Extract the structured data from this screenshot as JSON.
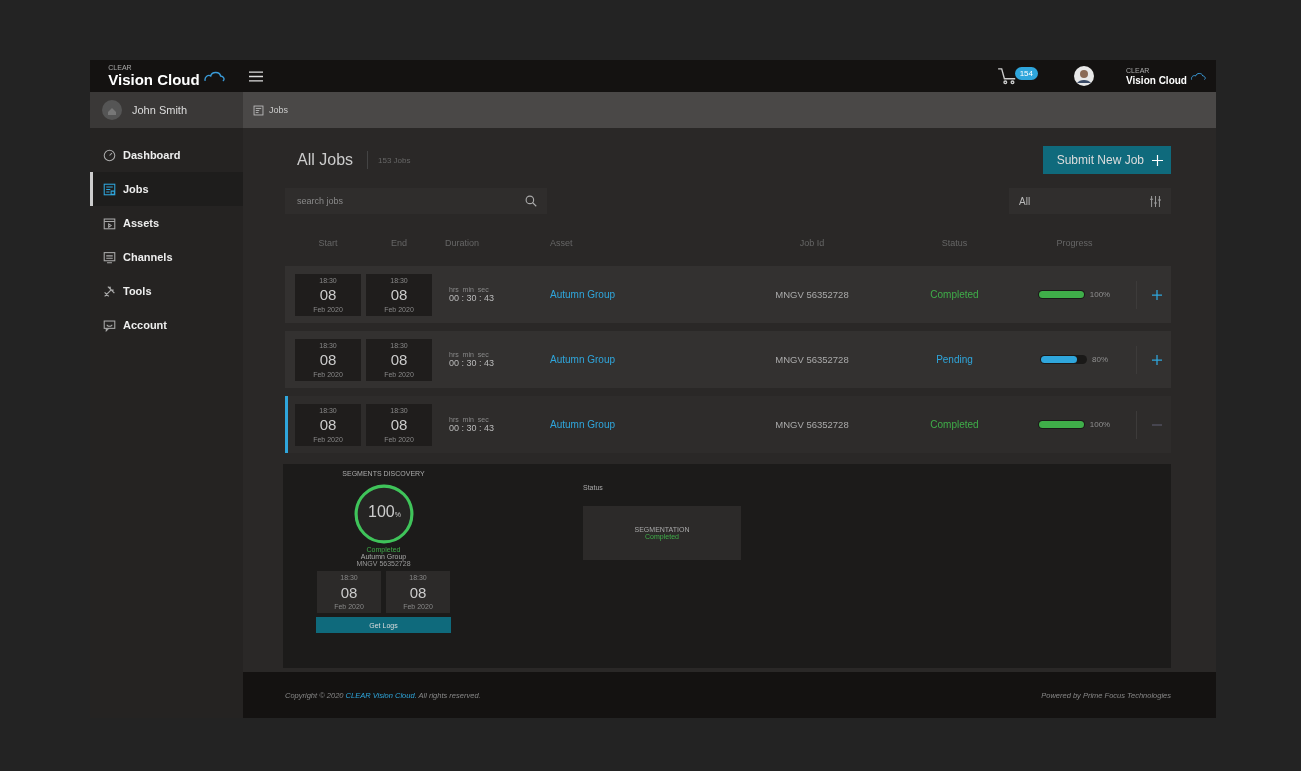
{
  "header": {
    "brand": {
      "tag": "CLEAR",
      "name": "Vision Cloud"
    },
    "cart_count": "154",
    "partner_brand": {
      "tag": "CLEAR",
      "name": "Vision Cloud"
    }
  },
  "sidebar": {
    "user": "John Smith",
    "items": [
      {
        "label": "Dashboard",
        "selected": false
      },
      {
        "label": "Jobs",
        "selected": true
      },
      {
        "label": "Assets",
        "selected": false
      },
      {
        "label": "Channels",
        "selected": false
      },
      {
        "label": "Tools",
        "selected": false
      },
      {
        "label": "Account",
        "selected": false
      }
    ]
  },
  "breadcrumb": "Jobs",
  "title": "All Jobs",
  "count": "153 Jobs",
  "submit_button": "Submit New Job",
  "search": {
    "placeholder": "search jobs"
  },
  "filter": {
    "value": "All"
  },
  "table": {
    "columns": [
      "Start",
      "End",
      "Duration",
      "Asset",
      "Job Id",
      "Status",
      "Progress"
    ],
    "rows": [
      {
        "start": {
          "time": "18:30",
          "day": "08",
          "month": "Feb 2020"
        },
        "end": {
          "time": "18:30",
          "day": "08",
          "month": "Feb 2020"
        },
        "duration_units": [
          "hrs",
          "min",
          "sec"
        ],
        "duration": "00 : 30 : 43",
        "asset": "Autumn Group",
        "job_id": "MNGV 56352728",
        "status": {
          "text": "Completed",
          "kind": "completed"
        },
        "level": 1,
        "reading": "100%",
        "expanded": false
      },
      {
        "start": {
          "time": "18:30",
          "day": "08",
          "month": "Feb 2020"
        },
        "end": {
          "time": "18:30",
          "day": "08",
          "month": "Feb 2020"
        },
        "duration_units": [
          "hrs",
          "min",
          "sec"
        ],
        "duration": "00 : 30 : 43",
        "asset": "Autumn Group",
        "job_id": "MNGV 56352728",
        "status": {
          "text": "Pending",
          "kind": "pending"
        },
        "level": 0.8,
        "reading": "80%",
        "expanded": false
      },
      {
        "start": {
          "time": "18:30",
          "day": "08",
          "month": "Feb 2020"
        },
        "end": {
          "time": "18:30",
          "day": "08",
          "month": "Feb 2020"
        },
        "duration_units": [
          "hrs",
          "min",
          "sec"
        ],
        "duration": "00 : 30 : 43",
        "asset": "Autumn Group",
        "job_id": "MNGV 56352728",
        "status": {
          "text": "Completed",
          "kind": "completed"
        },
        "level": 1,
        "reading": "100%",
        "expanded": true
      }
    ]
  },
  "detail": {
    "title": "SEGMENTS DISCOVERY",
    "percent": "100",
    "unit": "%",
    "level": 1,
    "status": "Completed",
    "asset": "Autumn Group",
    "job_id": "MNGV 56352728",
    "start": {
      "time": "18:30",
      "day": "08",
      "month": "Feb 2020"
    },
    "end": {
      "time": "18:30",
      "day": "08",
      "month": "Feb 2020"
    },
    "button": "Get Logs",
    "status_label": "Status",
    "stage": {
      "name": "SEGMENTATION",
      "status": "Completed"
    }
  },
  "footer": {
    "copyright_prefix": "Copyright © 2020 ",
    "copyright_link": "CLEAR Vision Cloud.",
    "copyright_suffix": " All rights reserved.",
    "powered": "Powered by Prime Focus Technologies"
  }
}
